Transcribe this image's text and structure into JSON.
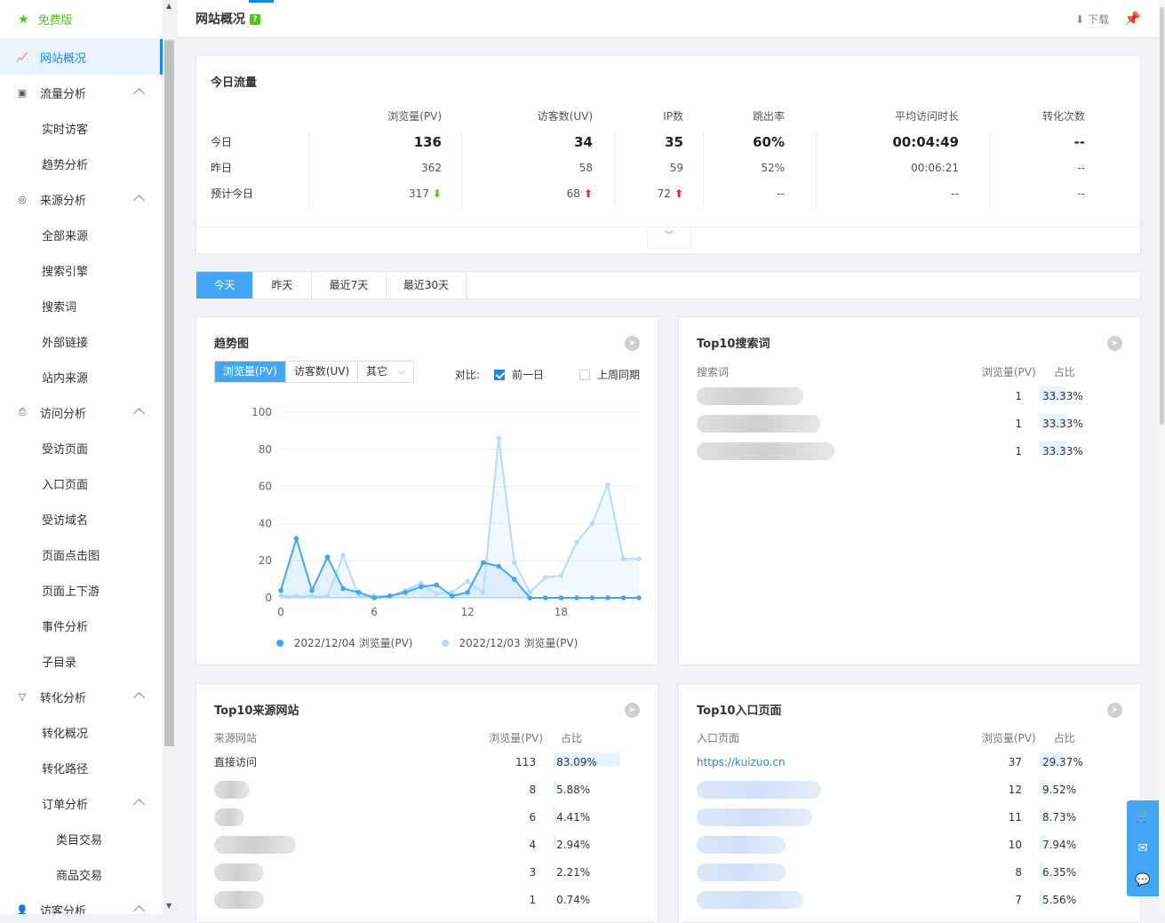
{
  "sidebar": {
    "free": "免费版",
    "items": [
      {
        "label": "网站概况",
        "level": 1,
        "icon": "chart-line-icon",
        "active": true
      },
      {
        "label": "流量分析",
        "level": 1,
        "icon": "traffic-icon",
        "chev": true
      },
      {
        "label": "实时访客",
        "level": 2
      },
      {
        "label": "趋势分析",
        "level": 2
      },
      {
        "label": "来源分析",
        "level": 1,
        "icon": "source-icon",
        "chev": true
      },
      {
        "label": "全部来源",
        "level": 2
      },
      {
        "label": "搜索引擎",
        "level": 2
      },
      {
        "label": "搜索词",
        "level": 2
      },
      {
        "label": "外部链接",
        "level": 2
      },
      {
        "label": "站内来源",
        "level": 2
      },
      {
        "label": "访问分析",
        "level": 1,
        "icon": "visit-icon",
        "chev": true
      },
      {
        "label": "受访页面",
        "level": 2
      },
      {
        "label": "入口页面",
        "level": 2
      },
      {
        "label": "受访域名",
        "level": 2
      },
      {
        "label": "页面点击图",
        "level": 2
      },
      {
        "label": "页面上下游",
        "level": 2
      },
      {
        "label": "事件分析",
        "level": 2
      },
      {
        "label": "子目录",
        "level": 2
      },
      {
        "label": "转化分析",
        "level": 1,
        "icon": "funnel-icon",
        "chev": true
      },
      {
        "label": "转化概况",
        "level": 2
      },
      {
        "label": "转化路径",
        "level": 2
      },
      {
        "label": "订单分析",
        "level": 2,
        "chev": true
      },
      {
        "label": "类目交易",
        "level": 3
      },
      {
        "label": "商品交易",
        "level": 3
      },
      {
        "label": "访客分析",
        "level": 1,
        "icon": "user-icon",
        "chev": true
      }
    ]
  },
  "topbar": {
    "title": "网站概况",
    "help": "?",
    "download": "下载"
  },
  "today": {
    "title": "今日流量",
    "headers": [
      "浏览量(PV)",
      "访客数(UV)",
      "IP数",
      "跳出率",
      "平均访问时长",
      "转化次数"
    ],
    "rows": [
      {
        "label": "今日",
        "values": [
          "136",
          "34",
          "35",
          "60%",
          "00:04:49",
          "--"
        ]
      },
      {
        "label": "昨日",
        "values": [
          "362",
          "58",
          "59",
          "52%",
          "00:06:21",
          "--"
        ]
      },
      {
        "label": "预计今日",
        "values": [
          "317",
          "68",
          "72",
          "--",
          "--",
          "--"
        ]
      }
    ]
  },
  "tabs": [
    "今天",
    "昨天",
    "最近7天",
    "最近30天"
  ],
  "trend": {
    "title": "趋势图",
    "metrics": [
      "浏览量(PV)",
      "访客数(UV)",
      "其它"
    ],
    "compare_label": "对比:",
    "compare_prev": "前一日",
    "compare_week": "上周同期"
  },
  "chart_data": {
    "type": "line",
    "x": [
      0,
      1,
      2,
      3,
      4,
      5,
      6,
      7,
      8,
      9,
      10,
      11,
      12,
      13,
      14,
      15,
      16,
      17,
      18,
      19,
      20,
      21,
      22,
      23
    ],
    "xticks": [
      "0",
      "6",
      "12",
      "18"
    ],
    "ylim": [
      0,
      100
    ],
    "yticks": [
      "0",
      "20",
      "40",
      "60",
      "80",
      "100"
    ],
    "series": [
      {
        "name": "2022/12/04 浏览量(PV)",
        "color": "#42a5f5",
        "values": [
          4,
          32,
          4,
          22,
          5,
          3,
          0,
          1,
          3,
          6,
          7,
          1,
          3,
          19,
          17,
          10,
          0,
          0,
          0,
          0,
          0,
          0,
          0,
          0
        ]
      },
      {
        "name": "2022/12/03 浏览量(PV)",
        "color": "#b3dcfb",
        "values": [
          1,
          1,
          1,
          1,
          23,
          1,
          1,
          1,
          4,
          8,
          2,
          3,
          9,
          3,
          86,
          19,
          3,
          11,
          12,
          30,
          40,
          61,
          21,
          21
        ]
      }
    ]
  },
  "search_words": {
    "title": "Top10搜索词",
    "headers": [
      "搜索词",
      "浏览量(PV)",
      "占比"
    ],
    "rows": [
      {
        "pv": "1",
        "pct": "33.33%",
        "ratio": 0.3333
      },
      {
        "pv": "1",
        "pct": "33.33%",
        "ratio": 0.3333
      },
      {
        "pv": "1",
        "pct": "33.33%",
        "ratio": 0.3333
      }
    ]
  },
  "source_sites": {
    "title": "Top10来源网站",
    "headers": [
      "来源网站",
      "浏览量(PV)",
      "占比"
    ],
    "rows": [
      {
        "name": "直接访问",
        "pv": "113",
        "pct": "83.09%",
        "ratio": 0.8309
      },
      {
        "name": "",
        "pv": "8",
        "pct": "5.88%",
        "ratio": 0.0588
      },
      {
        "name": "",
        "pv": "6",
        "pct": "4.41%",
        "ratio": 0.0441
      },
      {
        "name": "",
        "pv": "4",
        "pct": "2.94%",
        "ratio": 0.0294
      },
      {
        "name": "",
        "pv": "3",
        "pct": "2.21%",
        "ratio": 0.0221
      },
      {
        "name": "",
        "pv": "1",
        "pct": "0.74%",
        "ratio": 0.0074
      }
    ]
  },
  "entry_pages": {
    "title": "Top10入口页面",
    "headers": [
      "入口页面",
      "浏览量(PV)",
      "占比"
    ],
    "rows": [
      {
        "name": "https://kuizuo.cn",
        "pv": "37",
        "pct": "29.37%",
        "ratio": 0.2937
      },
      {
        "name": "",
        "pv": "12",
        "pct": "9.52%",
        "ratio": 0.0952
      },
      {
        "name": "",
        "pv": "11",
        "pct": "8.73%",
        "ratio": 0.0873
      },
      {
        "name": "",
        "pv": "10",
        "pct": "7.94%",
        "ratio": 0.0794
      },
      {
        "name": "",
        "pv": "8",
        "pct": "6.35%",
        "ratio": 0.0635
      },
      {
        "name": "",
        "pv": "7",
        "pct": "5.56%",
        "ratio": 0.0556
      }
    ]
  },
  "float": [
    "cart-icon",
    "mail-icon",
    "chat-icon"
  ]
}
